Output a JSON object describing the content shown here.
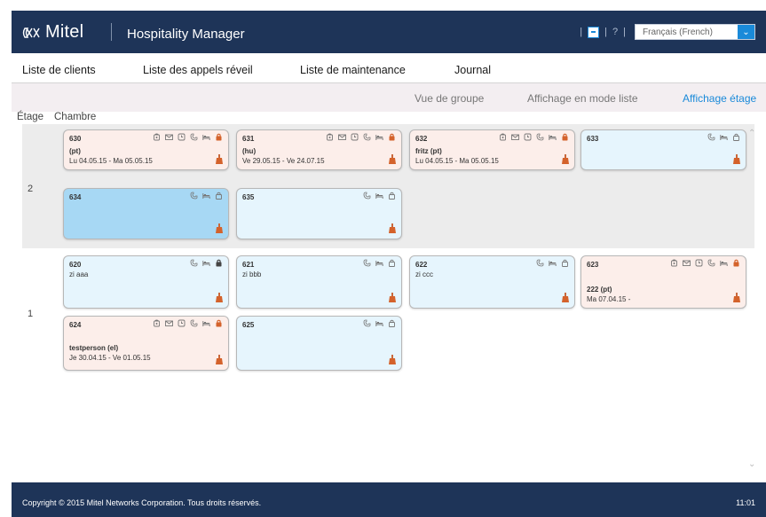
{
  "header": {
    "brand": "Mitel",
    "app_title": "Hospitality Manager",
    "separator_1": "|",
    "separator_2": "|",
    "help": "?",
    "separator_3": "|",
    "language": "Français (French)"
  },
  "nav": {
    "items": [
      {
        "label": "Liste de clients"
      },
      {
        "label": "Liste des appels réveil"
      },
      {
        "label": "Liste de maintenance"
      },
      {
        "label": "Journal"
      }
    ]
  },
  "views": {
    "group": "Vue de groupe",
    "list": "Affichage en mode liste",
    "floor": "Affichage étage"
  },
  "columns": {
    "floor": "Étage",
    "room": "Chambre"
  },
  "floors": [
    {
      "number": "2",
      "rooms": [
        {
          "no": "630",
          "guest": "(pt)",
          "dates": "Lu 04.05.15 - Ma 05.05.15"
        },
        {
          "no": "631",
          "guest": "(hu)",
          "dates": "Ve 29.05.15 - Ve 24.07.15"
        },
        {
          "no": "632",
          "guest": "fritz (pt)",
          "dates": "Lu 04.05.15 - Ma 05.05.15"
        },
        {
          "no": "633",
          "guest": "",
          "dates": ""
        },
        {
          "no": "634",
          "guest": "",
          "dates": ""
        },
        {
          "no": "635",
          "guest": "",
          "dates": ""
        }
      ]
    },
    {
      "number": "1",
      "rooms": [
        {
          "no": "620",
          "guest": "zi aaa",
          "dates": ""
        },
        {
          "no": "621",
          "guest": "zi bbb",
          "dates": ""
        },
        {
          "no": "622",
          "guest": "zi ccc",
          "dates": ""
        },
        {
          "no": "623",
          "guest": "222 (pt)",
          "dates": "Ma 07.04.15 -"
        },
        {
          "no": "624",
          "guest": "testperson (el)",
          "dates": "Je 30.04.15 - Ve 01.05.15"
        },
        {
          "no": "625",
          "guest": "",
          "dates": ""
        }
      ]
    }
  ],
  "footer": {
    "copyright": "Copyright © 2015 Mitel Networks Corporation. Tous droits réservés.",
    "clock": "11:01"
  },
  "colors": {
    "header_bg": "#1e3458",
    "accent": "#1a8ad9",
    "occupied_card": "#fceeea",
    "vacant_card": "#e6f5fd",
    "selected_card": "#a7d8f4",
    "lamp_orange": "#d4622b"
  },
  "icon_names": [
    "mitel-logo-icon",
    "exit-icon",
    "chevron-down-icon",
    "phone-lock-icon",
    "mail-icon",
    "alarm-clock-icon",
    "phone-icon",
    "bed-icon",
    "lock-icon",
    "cleaning-lamp-icon",
    "scroll-up-icon",
    "scroll-down-icon"
  ]
}
